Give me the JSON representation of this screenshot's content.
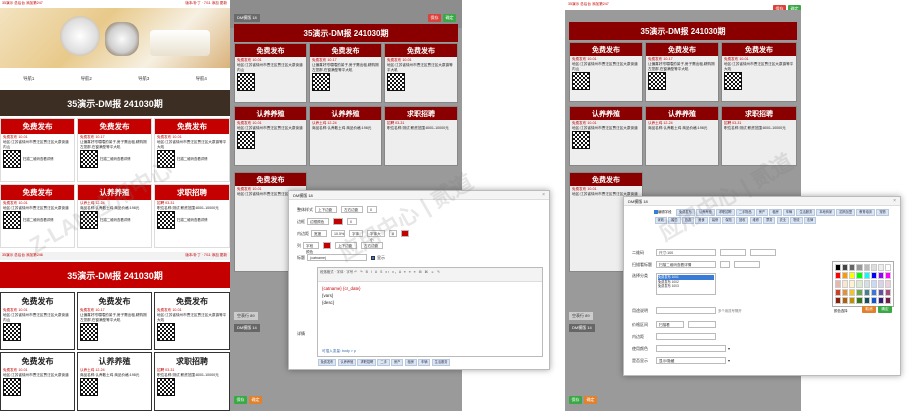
{
  "colors": {
    "red": "#c40000",
    "dark_banner": "#3c2e22",
    "green": "#3aa845",
    "orange": "#e0812e"
  },
  "left": {
    "top_links": "35演示 总后台 添加第247",
    "top_right": "版本/补丁 · 7/11 添加 更新",
    "nav": [
      "导航1",
      "导航2",
      "导航3",
      "导航4"
    ],
    "banner_title": "35演示-DM报 241030期",
    "cards_row1": [
      {
        "head": "免费发布",
        "sub": "免费发布 10-01",
        "body": "地区:江苏省徐州市贾汪区贾汪区大泉街道内山"
      },
      {
        "head": "免费发布",
        "sub": "免费发布 10-17",
        "body": "让偏喜好帘喂喂的弟子,房子需出租,精购刚左您那,在窗满型等平大吼"
      },
      {
        "head": "免费发布",
        "sub": "免费发布 10-01",
        "body": "地区:江苏省徐州市贾汪区贾汪区大泉镇等平大吼"
      }
    ],
    "cards_row2": [
      {
        "head": "免费发布",
        "sub": "免费发布 10-01",
        "body": "地区:江苏省徐州市贾汪区贾汪区大泉街道"
      },
      {
        "head": "认养养殖",
        "sub": "认养土鸡 12-24",
        "body": "商品名称:认养散土鸡 商品价格:198元"
      },
      {
        "head": "求职招聘",
        "sub": "招聘 03-31",
        "body": "职位名称:测试 薪资范围:8001-10000元"
      }
    ],
    "qr_text": "扫描二维码查看详情",
    "second_top": "35演示 总后台 添加第246",
    "second_right": "版本/补丁 · 7/11 添加 更新",
    "lower_row1": [
      {
        "head": "免费发布"
      },
      {
        "head": "免费发布"
      },
      {
        "head": "免费发布"
      }
    ],
    "lower_row2": [
      {
        "head": "免费发布"
      },
      {
        "head": "认养养殖"
      },
      {
        "head": "求职招聘"
      }
    ]
  },
  "middle": {
    "tab": "DM模版 18",
    "title": "35演示-DM报 241030期",
    "btn_save": "保存",
    "btn_ok": "确定",
    "row1": [
      "免费发布",
      "免费发布",
      "免费发布"
    ],
    "row2": [
      "认养养殖",
      "认养养殖",
      "求职招聘"
    ],
    "row3": [
      "免费发布"
    ],
    "bottom_tabs": [
      "DM模版 14",
      "空表行 89",
      "空表行 15"
    ],
    "foot_save": "保存",
    "foot_ok": "确定"
  },
  "dialog1": {
    "title": "DM模版 18",
    "labels": [
      "整体样式",
      "边框",
      "内边距",
      "列",
      "标题",
      "详情"
    ],
    "values": [
      "上下边距",
      "左右边距",
      "0",
      "边框颜色",
      "0",
      "0",
      "宽度",
      "10.5%",
      "字体",
      "字体大小",
      "8",
      "0",
      "字段颜色",
      "上下边距",
      "左右边距",
      "0"
    ],
    "title_field": "(catname)",
    "title_check": "显示",
    "toolbar_hint": "段落格式 · 字体 · 字号",
    "editor_lines": [
      "{catname} {cr_date}",
      "{vars}",
      "{desc}"
    ],
    "insert_label": "可插入变量: body > p",
    "check_label": "删除/新增",
    "tags": [
      "免费发布",
      "认养养殖",
      "求职招聘",
      "二手",
      "房产",
      "租房",
      "车辆",
      "生活服务"
    ]
  },
  "right": {
    "top_links": "35演示 总后台 添加第247",
    "btn_save": "保存",
    "btn_ok": "确定",
    "title": "35演示-DM报 241030期",
    "row1": [
      "免费发布",
      "免费发布",
      "免费发布"
    ],
    "row2": [
      "认养养殖",
      "认养养殖",
      "求职招聘"
    ],
    "row3": [
      "免费发布"
    ],
    "bottom_tabs": [
      "DM模版 14",
      "空表行 89"
    ],
    "foot_save": "保存",
    "foot_ok": "确定"
  },
  "dialog2": {
    "title": "DM模版 18",
    "check_label": "编辑字段",
    "tags": [
      "免费发布",
      "认养养殖",
      "求职招聘",
      "二手物品",
      "房产",
      "租房",
      "车辆",
      "生活服务",
      "本地商家",
      "招商加盟",
      "教育培训",
      "宠物",
      "家政",
      "婚恋",
      "旅游",
      "美食",
      "装修",
      "保险",
      "回收",
      "维修",
      "票务",
      "农业",
      "物流",
      "法律"
    ],
    "fields": [
      "二维码",
      "扫描看标题",
      "选择分类",
      "用途说明",
      "价格区间",
      "内边距",
      "使用颜色",
      "是否显示"
    ],
    "values": [
      "尺寸:100",
      "扫描二维码查看详情",
      "免费发布 1001",
      "免费发布 1002",
      "免费发布 1003",
      "多个用逗号隔开",
      "扫描看",
      "显示/隐藏"
    ],
    "palette_label": "颜色选择",
    "btn_cancel": "取消",
    "btn_confirm": "确定"
  }
}
